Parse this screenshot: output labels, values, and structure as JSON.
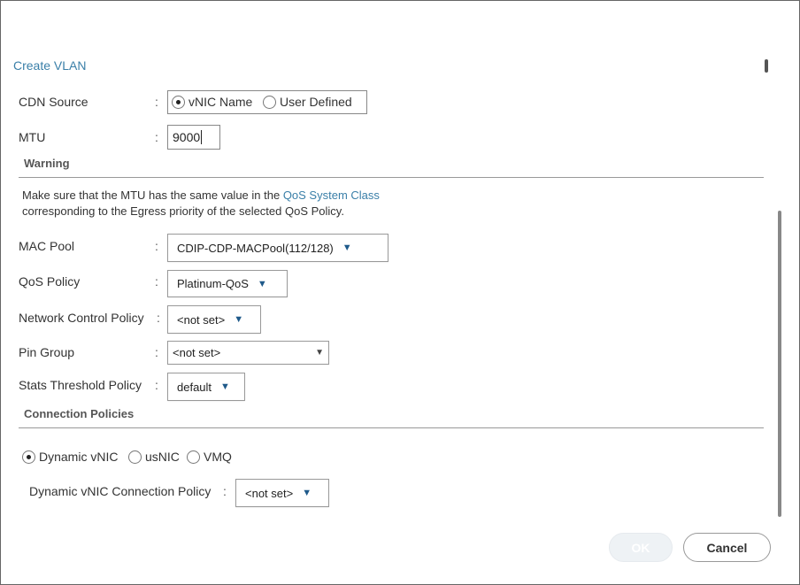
{
  "dialog": {
    "title": "Create VLAN"
  },
  "form": {
    "cdn_source": {
      "label": "CDN Source",
      "colon": ":",
      "options": [
        "vNIC Name",
        "User Defined"
      ],
      "selected": "vNIC Name"
    },
    "mtu": {
      "label": "MTU",
      "colon": ":",
      "value": "9000"
    },
    "warning": {
      "heading": "Warning",
      "text_before": "Make sure that the MTU has the same value in the ",
      "link": "QoS System Class",
      "text_after": "corresponding to the Egress priority of the selected QoS Policy."
    },
    "mac_pool": {
      "label": "MAC Pool",
      "colon": ":",
      "value": "CDIP-CDP-MACPool(112/128)"
    },
    "qos_policy": {
      "label": "QoS Policy",
      "colon": ":",
      "value": "Platinum-QoS"
    },
    "network_control_policy": {
      "label": "Network Control Policy",
      "colon": ":",
      "value": "<not set>"
    },
    "pin_group": {
      "label": "Pin Group",
      "colon": ":",
      "value": "<not set>"
    },
    "stats_threshold_policy": {
      "label": "Stats Threshold Policy",
      "colon": ":",
      "value": "default"
    }
  },
  "connection_policies": {
    "heading": "Connection Policies",
    "options": [
      "Dynamic vNIC",
      "usNIC",
      "VMQ"
    ],
    "selected": "Dynamic vNIC",
    "dynamic_vnic_policy": {
      "label": "Dynamic vNIC Connection Policy",
      "colon": ":",
      "value": "<not set>"
    }
  },
  "buttons": {
    "ok": "OK",
    "cancel": "Cancel"
  },
  "icons": {
    "dropdown": "dropdown-arrow-icon"
  },
  "colors": {
    "link": "#3a7fa8",
    "arrow": "#1f5a8a"
  }
}
